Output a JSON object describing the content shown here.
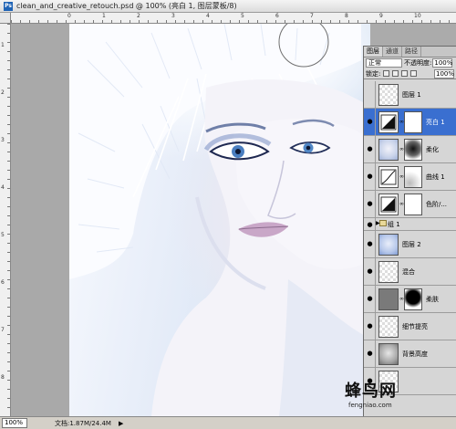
{
  "window": {
    "title": "clean_and_creative_retouch.psd @ 100% (亮白 1, 图层蒙板/8)",
    "app_icon": "photoshop-icon"
  },
  "rulers": {
    "top_labels": [
      "0",
      "1",
      "2",
      "3",
      "4",
      "5",
      "6",
      "7",
      "8",
      "9",
      "10"
    ],
    "left_labels": [
      "1",
      "2",
      "3",
      "4",
      "5",
      "6",
      "7",
      "8"
    ]
  },
  "status": {
    "zoom": "100%",
    "doc_info": "文档:1.87M/24.4M",
    "arrow": "▶"
  },
  "layers_panel": {
    "tabs": [
      "图层",
      "通道",
      "路径"
    ],
    "blend_mode": "正常",
    "opacity_label": "不透明度:",
    "opacity_value": "100%",
    "lock_label": "锁定:",
    "fill_value": "100%",
    "layers": [
      {
        "name": "图层 1",
        "visible": false,
        "thumb": "checker",
        "has_mask": false,
        "selected": false
      },
      {
        "name": "亮白 1",
        "visible": true,
        "thumb": "levels-icon",
        "has_mask": true,
        "selected": true
      },
      {
        "name": "柔化",
        "visible": true,
        "thumb": "face-small",
        "has_mask": true,
        "selected": false
      },
      {
        "name": "曲线 1",
        "visible": true,
        "thumb": "curves-icon",
        "has_mask": true,
        "selected": false
      },
      {
        "name": "色阶/...",
        "visible": true,
        "thumb": "levels-icon",
        "has_mask": true,
        "selected": false
      },
      {
        "name": "组 1",
        "visible": true,
        "group": true
      },
      {
        "name": "图层 2",
        "visible": true,
        "thumb": "face-blue",
        "has_mask": false,
        "selected": false
      },
      {
        "name": "混合",
        "visible": true,
        "thumb": "checker",
        "has_mask": false,
        "selected": false
      },
      {
        "name": "柔肤",
        "visible": true,
        "thumb": "gray",
        "has_mask": true,
        "selected": false
      },
      {
        "name": "细节提亮",
        "visible": true,
        "thumb": "checker",
        "has_mask": false,
        "selected": false
      },
      {
        "name": "背景高度",
        "visible": true,
        "thumb": "face-gray",
        "has_mask": false,
        "selected": false
      },
      {
        "name": "",
        "visible": true,
        "thumb": "checker",
        "has_mask": false,
        "selected": false
      }
    ]
  },
  "watermark": {
    "text": "蜂鸟网",
    "url": "fengniao.com"
  },
  "colors": {
    "selection": "#3a6fd0",
    "panel": "#d6d6d6",
    "canvas_bg": "#a9a9a9"
  }
}
